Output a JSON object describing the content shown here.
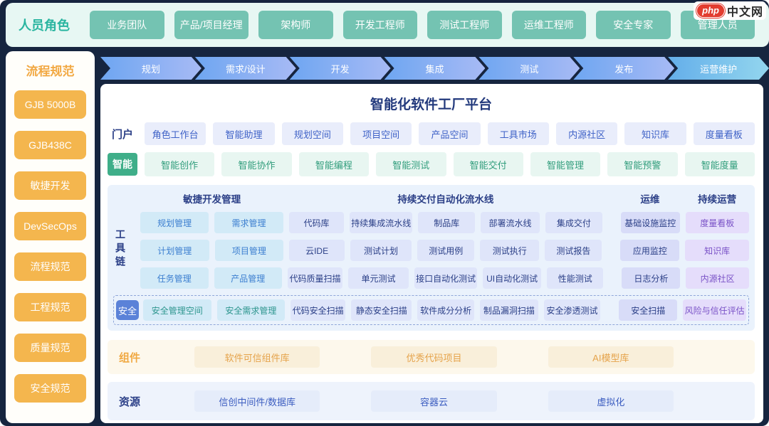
{
  "colors": {
    "teal_accent": "#2ab5a0",
    "role_button_green": "#74c3b2",
    "orange_accent": "#f2a944",
    "navy_background": "#16253f",
    "blue_primary": "#2b3f87",
    "ai_green": "#3fae89",
    "purple_accent": "#7a52c7",
    "security_badge_blue": "#5b82d8",
    "logo_red": "#e23c2f"
  },
  "logo": {
    "badge": "php",
    "site": "中文网"
  },
  "roles_bar": {
    "label": "人员角色",
    "roles": [
      "业务团队",
      "产品/项目经理",
      "架构师",
      "开发工程师",
      "测试工程师",
      "运维工程师",
      "安全专家",
      "管理人员"
    ]
  },
  "sidebar": {
    "title": "流程规范",
    "items": [
      "GJB 5000B",
      "GJB438C",
      "敏捷开发",
      "DevSecOps",
      "流程规范",
      "工程规范",
      "质量规范",
      "安全规范"
    ]
  },
  "pipeline": {
    "stages": [
      "规划",
      "需求/设计",
      "开发",
      "集成",
      "测试",
      "发布",
      "运营维护"
    ]
  },
  "platform": {
    "title": "智能化软件工厂平台",
    "portal": {
      "label": "门户",
      "items": [
        "角色工作台",
        "智能助理",
        "规划空间",
        "项目空间",
        "产品空间",
        "工具市场",
        "内源社区",
        "知识库",
        "度量看板"
      ]
    },
    "ai": {
      "label": "智能",
      "items": [
        "智能创作",
        "智能协作",
        "智能编程",
        "智能测试",
        "智能交付",
        "智能管理",
        "智能预警",
        "智能度量"
      ]
    },
    "toolchain": {
      "label": "工具链",
      "group_headers": {
        "agile": "敏捷开发管理",
        "cd": "持续交付自动化流水线",
        "ops": "运维",
        "sustain": "持续运营"
      },
      "rows": [
        {
          "agile": [
            "规划管理",
            "需求管理"
          ],
          "cd": [
            "代码库",
            "持续集成流水线",
            "制品库",
            "部署流水线",
            "集成交付"
          ],
          "ops": "基础设施监控",
          "sustain": "度量看板"
        },
        {
          "agile": [
            "计划管理",
            "项目管理"
          ],
          "cd": [
            "云IDE",
            "测试计划",
            "测试用例",
            "测试执行",
            "测试报告"
          ],
          "ops": "应用监控",
          "sustain": "知识库"
        },
        {
          "agile": [
            "任务管理",
            "产品管理"
          ],
          "cd": [
            "代码质量扫描",
            "单元测试",
            "接口自动化测试",
            "UI自动化测试",
            "性能测试"
          ],
          "ops": "日志分析",
          "sustain": "内源社区"
        }
      ],
      "security_row": {
        "label": "安全",
        "agile": [
          "安全管理空间",
          "安全需求管理"
        ],
        "cd": [
          "代码安全扫描",
          "静态安全扫描",
          "软件成分分析",
          "制品漏洞扫描",
          "安全渗透测试"
        ],
        "ops": "安全扫描",
        "sustain": "风险与信任评估"
      }
    },
    "components": {
      "label": "组件",
      "items": [
        "软件可信组件库",
        "优秀代码项目",
        "AI模型库"
      ]
    },
    "resources": {
      "label": "资源",
      "items": [
        "信创中间件/数据库",
        "容器云",
        "虚拟化"
      ]
    }
  }
}
